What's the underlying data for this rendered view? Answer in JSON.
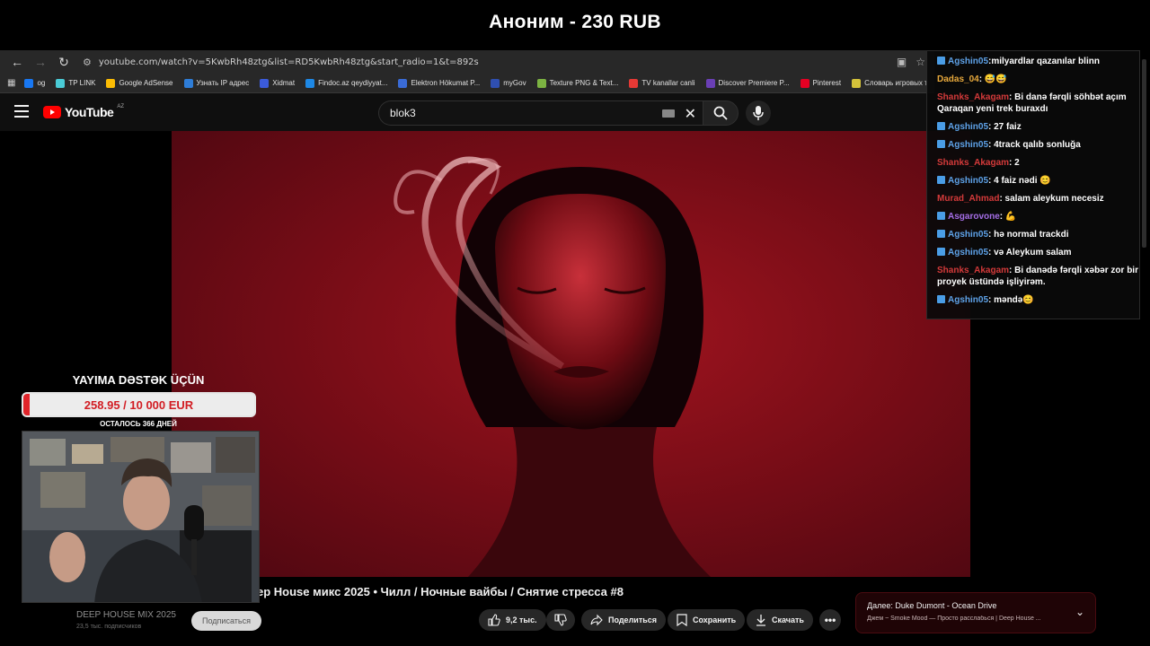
{
  "donation": {
    "banner": "Аноним - 230 RUB"
  },
  "browser": {
    "url": "youtube.com/watch?v=5KwbRh48ztg&list=RD5KwbRh48ztg&start_radio=1&t=892s",
    "bookmarks": [
      {
        "label": "og",
        "color": "#1877f2"
      },
      {
        "label": "TP LINK",
        "color": "#4acbd6"
      },
      {
        "label": "Google AdSense",
        "color": "#fbbc04"
      },
      {
        "label": "Узнать IP адрес",
        "color": "#2e7dd7"
      },
      {
        "label": "Xidmat",
        "color": "#3b5bdb"
      },
      {
        "label": "Findoc.az qeydiyyat...",
        "color": "#1e88e5"
      },
      {
        "label": "Elektron Hökumat P...",
        "color": "#3a6bd6"
      },
      {
        "label": "myGov",
        "color": "#2f4fb0"
      },
      {
        "label": "Texture PNG & Text...",
        "color": "#7cb342"
      },
      {
        "label": "TV kanallar canli",
        "color": "#e53935"
      },
      {
        "label": "Discover Premiere P...",
        "color": "#6a3fb5"
      },
      {
        "label": "Pinterest",
        "color": "#e60023"
      },
      {
        "label": "Словарь игровых т",
        "color": "#d4c23a"
      }
    ]
  },
  "youtube": {
    "logo": "YouTube",
    "region": "AZ",
    "search_value": "blok3",
    "video_title": "ep House микс 2025 • Чилл / Ночные вайбы / Снятие стресса #8",
    "channel": "DEEP HOUSE MIX 2025",
    "subscribers": "23,5 тыс. подписчиков",
    "subscribe": "Подписаться",
    "likes": "9,2 тыс.",
    "share": "Поделиться",
    "save": "Сохранить",
    "download": "Скачать",
    "up_next_title": "Далее: Duke Dumont - Ocean Drive",
    "up_next_desc": "Джем ~ Smoke Mood — Просто расслабься | Deep House ..."
  },
  "chat": [
    {
      "user": "Agshin05",
      "color": "#5ea2e8",
      "badge": true,
      "text": ":milyardlar qazanılar blinn"
    },
    {
      "user": "Dadas_04",
      "color": "#e8a93c",
      "badge": false,
      "text": ": 😅😅"
    },
    {
      "user": "Shanks_Akagam",
      "color": "#d43a3a",
      "badge": false,
      "text": ": Bi danə fərqli söhbət açım Qaraqan yeni trek buraxdı"
    },
    {
      "user": "Agshin05",
      "color": "#5ea2e8",
      "badge": true,
      "text": ": 27 faiz"
    },
    {
      "user": "Agshin05",
      "color": "#5ea2e8",
      "badge": true,
      "text": ": 4track qalıb sonluğa"
    },
    {
      "user": "Shanks_Akagam",
      "color": "#d43a3a",
      "badge": false,
      "text": ": 2"
    },
    {
      "user": "Agshin05",
      "color": "#5ea2e8",
      "badge": true,
      "text": ": 4 faiz nədi 😊"
    },
    {
      "user": "Murad_Ahmad",
      "color": "#d43a3a",
      "badge": false,
      "text": ": salam aleykum necesiz"
    },
    {
      "user": "Asgarovone",
      "color": "#a56ee6",
      "badge": true,
      "text": ": 💪"
    },
    {
      "user": "Agshin05",
      "color": "#5ea2e8",
      "badge": true,
      "text": ": hə normal trackdi"
    },
    {
      "user": "Agshin05",
      "color": "#5ea2e8",
      "badge": true,
      "text": ": və Aleykum salam"
    },
    {
      "user": "Shanks_Akagam",
      "color": "#d43a3a",
      "badge": false,
      "text": ": Bi danədə fərqli xəbər zor bir proyek üstündə işliyirəm."
    },
    {
      "user": "Agshin05",
      "color": "#5ea2e8",
      "badge": true,
      "text": ": məndə😊"
    }
  ],
  "goal": {
    "title": "YAYIMA DƏSTƏK ÜÇÜN",
    "amount": "258.95 / 10 000 EUR",
    "progress_percent": 2.6,
    "days_left": "ОСТАЛОСЬ 366 ДНЕЙ"
  }
}
